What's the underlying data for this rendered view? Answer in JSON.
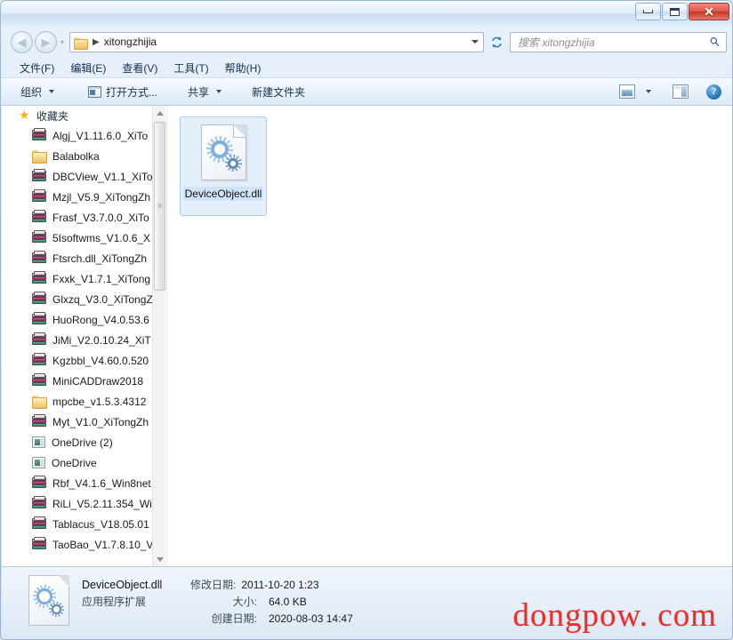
{
  "window": {
    "titlebar": {
      "minimize_label": "—",
      "maximize_label": "",
      "close_label": "✕"
    }
  },
  "address_bar": {
    "back_label": "◀",
    "forward_label": "▶",
    "folder_icon": "folder-icon",
    "separator": "▶",
    "path_text": "xitongzhijia",
    "dropdown_icon": "chevron-down-icon",
    "refresh_label": "↻"
  },
  "search": {
    "placeholder": "搜索 xitongzhijia",
    "icon": "search-icon"
  },
  "menu": {
    "items": [
      {
        "label": "文件(F)"
      },
      {
        "label": "编辑(E)"
      },
      {
        "label": "查看(V)"
      },
      {
        "label": "工具(T)"
      },
      {
        "label": "帮助(H)"
      }
    ]
  },
  "toolbar": {
    "organize_label": "组织",
    "open_with_label": "打开方式...",
    "share_label": "共享",
    "new_folder_label": "新建文件夹",
    "view_icon": "view-layout-icon",
    "preview_pane_icon": "preview-pane-icon",
    "help_icon": "help-icon",
    "help_glyph": "?"
  },
  "sidebar": {
    "header": {
      "label": "收藏夹",
      "icon": "star-icon"
    },
    "items": [
      {
        "label": "Algj_V1.11.6.0_XiTo",
        "icon": "archive-icon"
      },
      {
        "label": "Balabolka",
        "icon": "folder-icon"
      },
      {
        "label": "DBCView_V1.1_XiTo",
        "icon": "archive-icon"
      },
      {
        "label": "Mzjl_V5.9_XiTongZh",
        "icon": "archive-icon"
      },
      {
        "label": "Frasf_V3.7.0.0_XiTo",
        "icon": "archive-icon"
      },
      {
        "label": "5Isoftwms_V1.0.6_X",
        "icon": "archive-icon"
      },
      {
        "label": "Ftsrch.dll_XiTongZh",
        "icon": "archive-icon"
      },
      {
        "label": "Fxxk_V1.7.1_XiTong",
        "icon": "archive-icon"
      },
      {
        "label": "Glxzq_V3.0_XiTongZ",
        "icon": "archive-icon"
      },
      {
        "label": "HuoRong_V4.0.53.6",
        "icon": "archive-icon"
      },
      {
        "label": "JiMi_V2.0.10.24_XiT",
        "icon": "archive-icon"
      },
      {
        "label": "Kgzbbl_V4.60.0.520",
        "icon": "archive-icon"
      },
      {
        "label": "MiniCADDraw2018",
        "icon": "archive-icon"
      },
      {
        "label": "mpcbe_v1.5.3.4312",
        "icon": "folder-icon"
      },
      {
        "label": "Myt_V1.0_XiTongZh",
        "icon": "archive-icon"
      },
      {
        "label": "OneDrive (2)",
        "icon": "drive-icon"
      },
      {
        "label": "OneDrive",
        "icon": "drive-icon"
      },
      {
        "label": "Rbf_V4.1.6_Win8net",
        "icon": "archive-icon"
      },
      {
        "label": "RiLi_V5.2.11.354_Wi",
        "icon": "archive-icon"
      },
      {
        "label": "Tablacus_V18.05.01",
        "icon": "archive-icon"
      },
      {
        "label": "TaoBao_V1.7.8.10_V",
        "icon": "archive-icon"
      }
    ],
    "scrollbar": {
      "up_icon": "scroll-up-icon",
      "down_icon": "scroll-down-icon"
    }
  },
  "content": {
    "files": [
      {
        "name": "DeviceObject.dll",
        "icon": "dll-file-icon",
        "selected": true
      }
    ]
  },
  "details": {
    "file_name": "DeviceObject.dll",
    "file_type": "应用程序扩展",
    "modified_key": "修改日期:",
    "modified_value": "2011-10-20 1:23",
    "size_key": "大小:",
    "size_value": "64.0 KB",
    "created_key": "创建日期:",
    "created_value": "2020-08-03 14:47"
  },
  "watermark": {
    "text": "dongpow. com",
    "color": "#e8302a"
  }
}
